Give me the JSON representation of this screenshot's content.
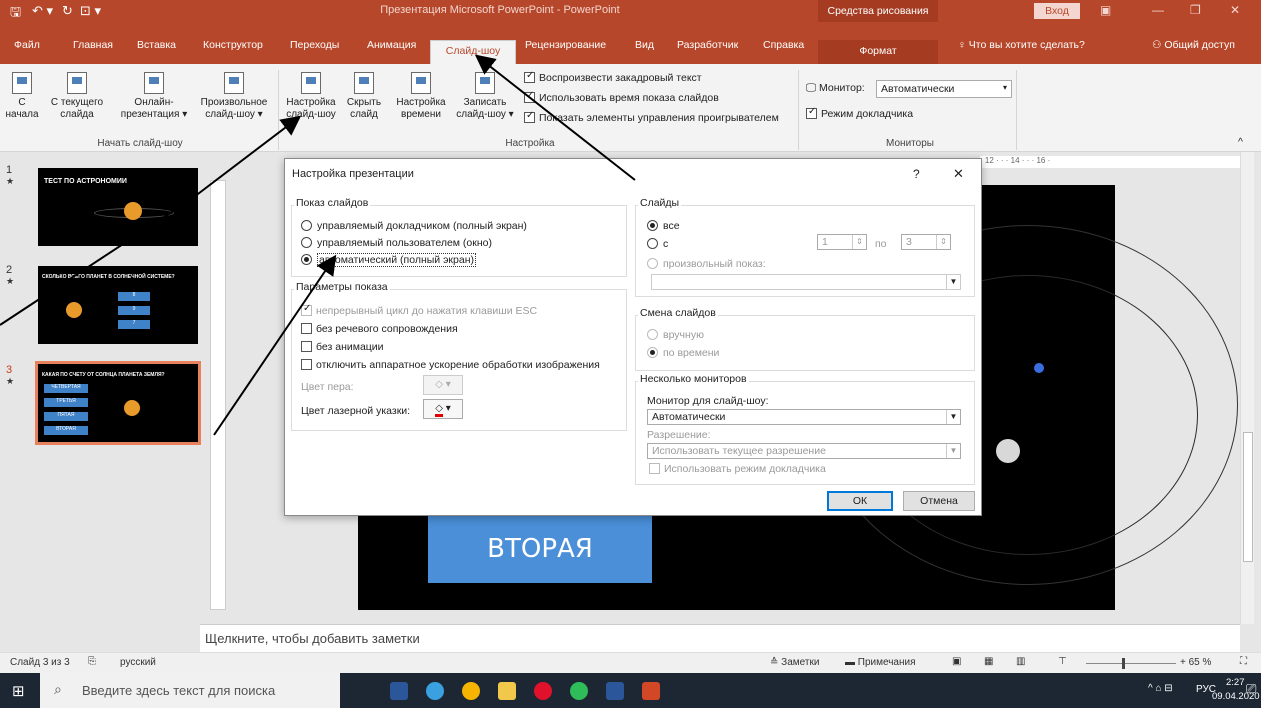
{
  "app": {
    "title": "Презентация Microsoft PowerPoint - PowerPoint",
    "drawing_tools": "Средства рисования",
    "login": "Вход"
  },
  "tabs": [
    "Файл",
    "Главная",
    "Вставка",
    "Конструктор",
    "Переходы",
    "Анимация",
    "Слайд-шоу",
    "Рецензирование",
    "Вид",
    "Разработчик",
    "Справка",
    "Формат"
  ],
  "tell_me": "Что вы хотите сделать?",
  "share": "Общий доступ",
  "ribbon": {
    "btn_from_start": [
      "С",
      "начала"
    ],
    "btn_from_current": [
      "С текущего",
      "слайда"
    ],
    "btn_online": [
      "Онлайн-",
      "презентация ▾"
    ],
    "btn_custom": [
      "Произвольное",
      "слайд-шоу ▾"
    ],
    "btn_setup": [
      "Настройка",
      "слайд-шоу"
    ],
    "btn_hide": [
      "Скрыть",
      "слайд"
    ],
    "btn_timings": [
      "Настройка",
      "времени"
    ],
    "btn_record": [
      "Записать",
      "слайд-шоу ▾"
    ],
    "chk_narration": "Воспроизвести закадровый текст",
    "chk_timings": "Использовать время показа слайдов",
    "chk_media": "Показать элементы управления проигрывателем",
    "grp_start": "Начать слайд-шоу",
    "grp_setup": "Настройка",
    "monitor_label": "Монитор:",
    "monitor_value": "Автоматически",
    "chk_presenter": "Режим докладчика",
    "grp_monitors": "Мониторы"
  },
  "thumbs": {
    "s1_num": "1",
    "s1_title": "ТЕСТ ПО АСТРОНОМИИ",
    "s2_num": "2",
    "s2_title": "СКОЛЬКО ВСЕГО ПЛАНЕТ В СОЛНЕЧНОЙ СИСТЕМЕ?",
    "s2_b1": "8",
    "s2_b2": "9",
    "s2_b3": "7",
    "s3_num": "3",
    "s3_title": "КАКАЯ ПО СЧЕТУ ОТ СОЛНЦА ПЛАНЕТА ЗЕМЛЯ?",
    "s3_b1": "ЧЕТВЕРТАЯ",
    "s3_b2": "ТРЕТЬЯ",
    "s3_b3": "ПЯТАЯ",
    "s3_b4": "ВТОРАЯ"
  },
  "slide": {
    "answer": "ВТОРАЯ"
  },
  "ruler": "· 12 · · · 14 · · · 16 ·",
  "dialog": {
    "title": "Настройка презентации",
    "help": "?",
    "close": "✕",
    "show_type": "Показ слайдов",
    "opt1": "управляемый докладчиком (полный экран)",
    "opt2": "управляемый пользователем (окно)",
    "opt3": "автоматический (полный экран)",
    "show_options": "Параметры показа",
    "loop": "непрерывный цикл до нажатия клавиши ESC",
    "no_narration": "без речевого сопровождения",
    "no_animation": "без анимации",
    "no_hw": "отключить аппаратное ускорение обработки изображения",
    "pen_color": "Цвет пера:",
    "laser_color": "Цвет лазерной указки:",
    "slides": "Слайды",
    "all": "все",
    "from": "с",
    "from_val": "1",
    "to": "по",
    "to_val": "3",
    "custom": "произвольный показ:",
    "advance": "Смена слайдов",
    "manual": "вручную",
    "timed": "по времени",
    "multi": "Несколько мониторов",
    "monitor_label": "Монитор для слайд-шоу:",
    "monitor_val": "Автоматически",
    "res_label": "Разрешение:",
    "res_val": "Использовать текущее разрешение",
    "use_presenter": "Использовать режим докладчика",
    "ok": "ОК",
    "cancel": "Отмена"
  },
  "notes": "Щелкните, чтобы добавить заметки",
  "status": {
    "slide": "Слайд 3 из 3",
    "lang": "русский",
    "notes": "Заметки",
    "comments": "Примечания",
    "zoom": "65 %"
  },
  "taskbar": {
    "search": "Введите здесь текст для поиска",
    "lang": "РУС",
    "time": "2:27",
    "date": "09.04.2020"
  }
}
